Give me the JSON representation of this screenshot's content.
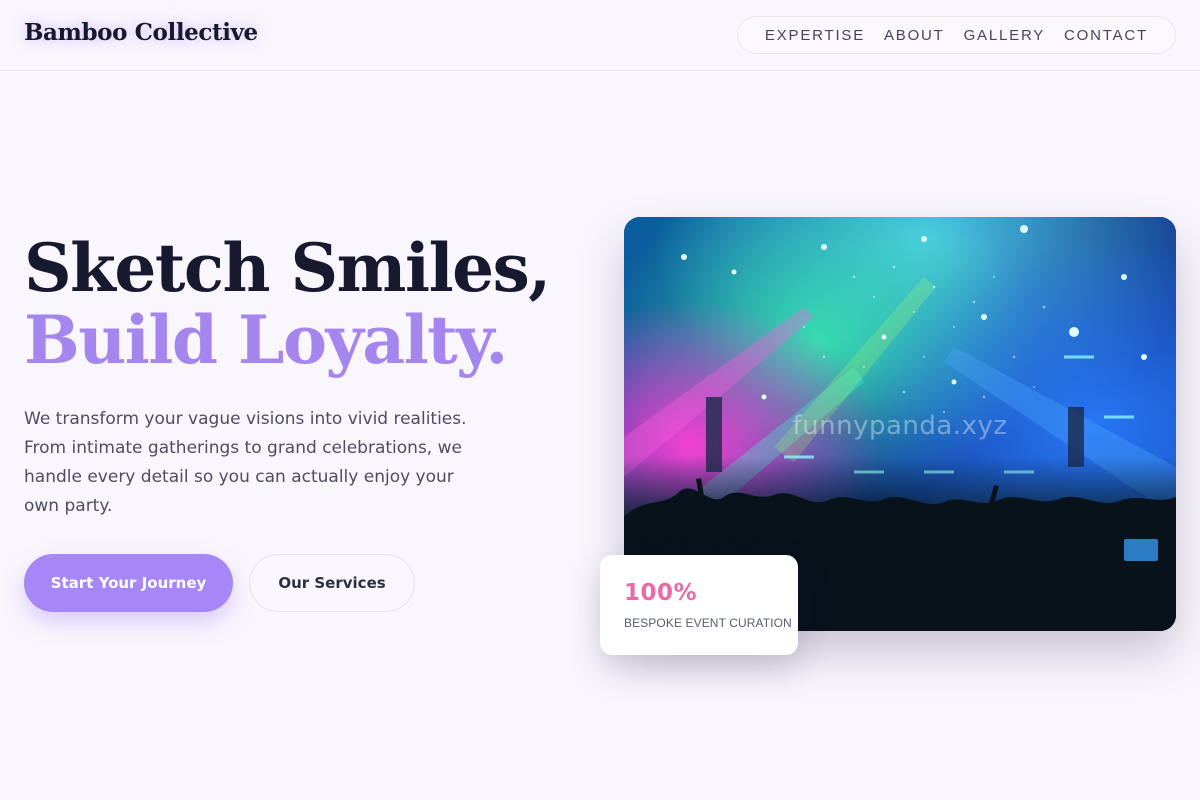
{
  "header": {
    "brand": "Bamboo Collective",
    "nav": [
      {
        "label": "EXPERTISE"
      },
      {
        "label": "ABOUT"
      },
      {
        "label": "GALLERY"
      },
      {
        "label": "CONTACT"
      }
    ]
  },
  "hero": {
    "headline_line1": "Sketch Smiles,",
    "headline_line2": "Build Loyalty.",
    "description": "We transform your vague visions into vivid realities. From intimate gatherings to grand celebrations, we handle every detail so you can actually enjoy your own party.",
    "primary_button": "Start Your Journey",
    "secondary_button": "Our Services",
    "image_watermark": "funnypanda.xyz",
    "stat": {
      "value": "100%",
      "label": "BESPOKE EVENT CURATION"
    }
  },
  "colors": {
    "background": "#faf6fd",
    "accent": "#a786f7",
    "stat_accent": "#ea6aa6",
    "heading": "#171a2e"
  }
}
